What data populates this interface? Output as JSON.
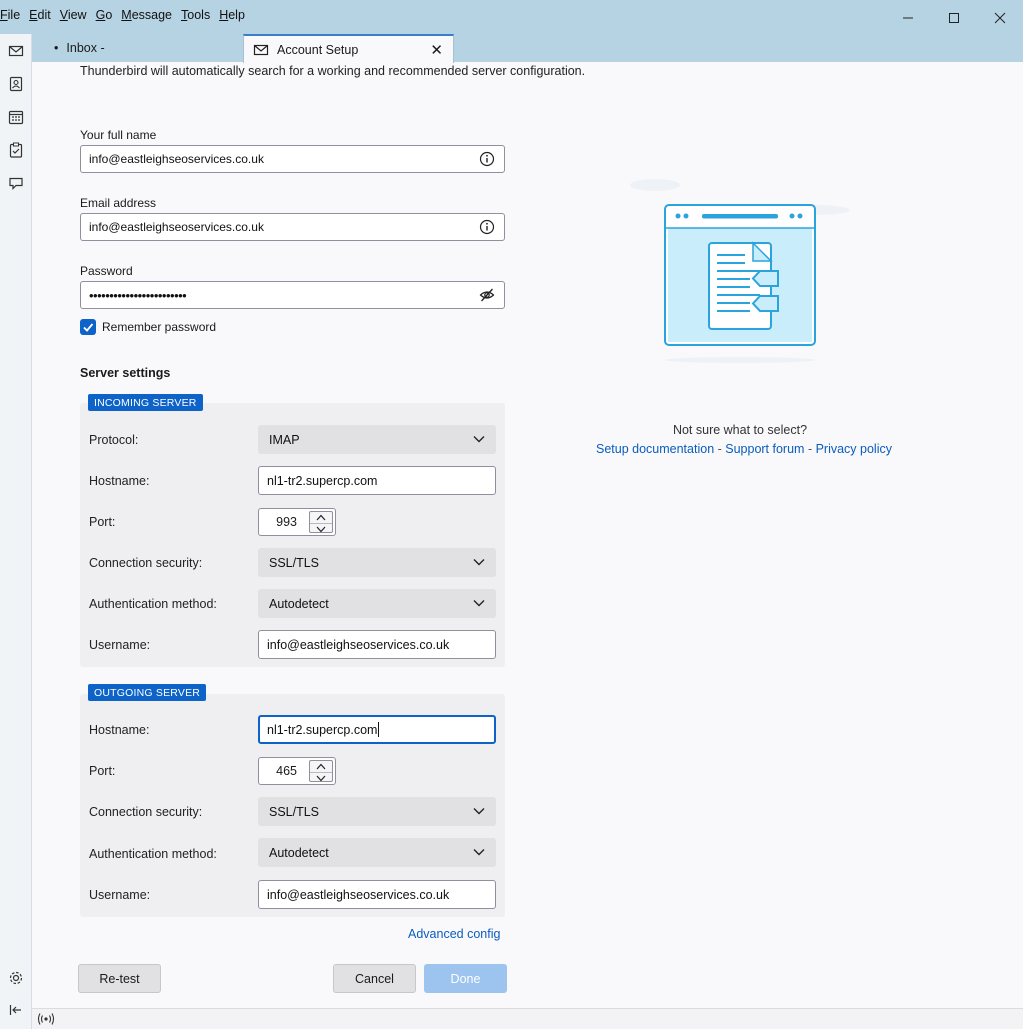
{
  "menu": [
    "File",
    "Edit",
    "View",
    "Go",
    "Message",
    "Tools",
    "Help"
  ],
  "tabs": {
    "inbox": "Inbox -",
    "account_setup": "Account Setup"
  },
  "intro": "Thunderbird will automatically search for a working and recommended server configuration.",
  "identity": {
    "full_name_label": "Your full name",
    "full_name_value": "info@eastleighseoservices.co.uk",
    "email_label": "Email address",
    "email_value": "info@eastleighseoservices.co.uk",
    "password_label": "Password",
    "password_value": "••••••••••••••••••••••••",
    "remember_label": "Remember password",
    "remember_checked": true
  },
  "server_settings_title": "Server settings",
  "incoming": {
    "badge": "INCOMING SERVER",
    "protocol_label": "Protocol:",
    "protocol_value": "IMAP",
    "hostname_label": "Hostname:",
    "hostname_value": "nl1-tr2.supercp.com",
    "port_label": "Port:",
    "port_value": "993",
    "security_label": "Connection security:",
    "security_value": "SSL/TLS",
    "auth_label": "Authentication method:",
    "auth_value": "Autodetect",
    "username_label": "Username:",
    "username_value": "info@eastleighseoservices.co.uk"
  },
  "outgoing": {
    "badge": "OUTGOING SERVER",
    "hostname_label": "Hostname:",
    "hostname_value": "nl1-tr2.supercp.com",
    "port_label": "Port:",
    "port_value": "465",
    "security_label": "Connection security:",
    "security_value": "SSL/TLS",
    "auth_label": "Authentication method:",
    "auth_value": "Autodetect",
    "username_label": "Username:",
    "username_value": "info@eastleighseoservices.co.uk"
  },
  "advanced_config": "Advanced config",
  "buttons": {
    "retest": "Re-test",
    "cancel": "Cancel",
    "done": "Done"
  },
  "help": {
    "question": "Not sure what to select?",
    "setup_docs": "Setup documentation",
    "separator": " - ",
    "support_forum": "Support forum",
    "privacy_policy": "Privacy policy"
  },
  "colors": {
    "titlebar": "#b6d3e3",
    "accent": "#0d63c8",
    "link": "#0b5cbd",
    "done_disabled": "#9cc4ee"
  },
  "icons": {
    "spaces": [
      "mail-icon",
      "address-book-icon",
      "calendar-icon",
      "tasks-icon",
      "chat-icon",
      "settings-icon",
      "collapse-icon"
    ],
    "status": "online-status-icon"
  }
}
